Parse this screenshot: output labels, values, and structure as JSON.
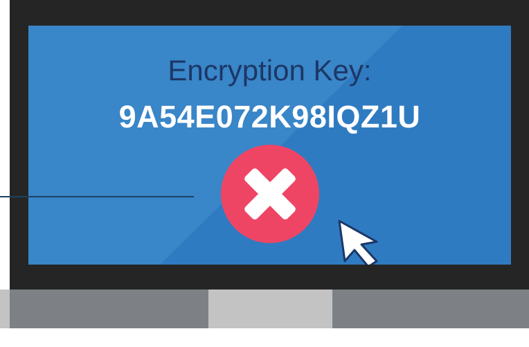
{
  "screen": {
    "label": "Encryption Key:",
    "key": "9A54E072K98IQZ1U"
  },
  "icons": {
    "close": "close-icon",
    "cursor": "cursor-arrow-icon"
  },
  "colors": {
    "screen": "#2f7bc1",
    "label": "#1c3767",
    "key": "#ffffff",
    "close_button": "#ef4565",
    "bezel": "#252525",
    "stand_dark": "#7d8186",
    "stand_light": "#c3c3c4"
  }
}
